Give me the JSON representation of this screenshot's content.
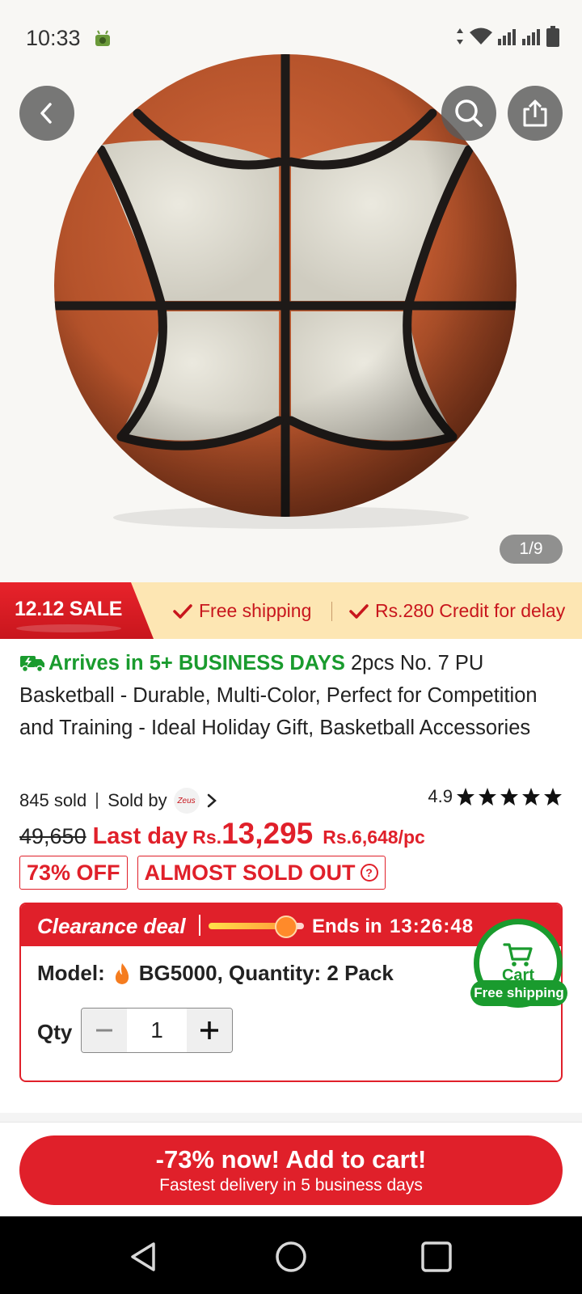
{
  "status": {
    "time": "10:33"
  },
  "gallery": {
    "indicator": "1/9"
  },
  "banner": {
    "sale_label": "12.12 SALE",
    "perk_1": "Free shipping",
    "perk_2": "Rs.280 Credit for delay"
  },
  "product": {
    "arrives": "Arrives in 5+ BUSINESS DAYS",
    "title": "2pcs No. 7 PU Basketball - Durable, Multi-Color, Perfect for Competition and Training - Ideal Holiday Gift, Basketball Accessories",
    "sold": "845 sold",
    "sold_by": "Sold by",
    "seller_logo_text": "Zeus",
    "rating": "4.9",
    "rating_stars": 5
  },
  "price": {
    "old": "49,650",
    "last_day": "Last day",
    "currency": "Rs.",
    "current": "13,295",
    "per_pc": "Rs.6,648/pc",
    "discount_tag": "73% OFF",
    "stock_tag": "ALMOST SOLD OUT"
  },
  "deal": {
    "label": "Clearance deal",
    "ends_label": "Ends in",
    "ends_time": "13:26:48",
    "model_line": "Model:",
    "model_value": "BG5000, Quantity: 2 Pack",
    "qty_label": "Qty",
    "qty_value": "1"
  },
  "cart_float": {
    "label": "Cart",
    "pill": "Free shipping"
  },
  "cta": {
    "main": "-73% now! Add to cart!",
    "sub": "Fastest delivery in 5 business days"
  },
  "colors": {
    "accent": "#e0202a",
    "green": "#1a9b2e",
    "banner_bg": "#fde6b3"
  }
}
